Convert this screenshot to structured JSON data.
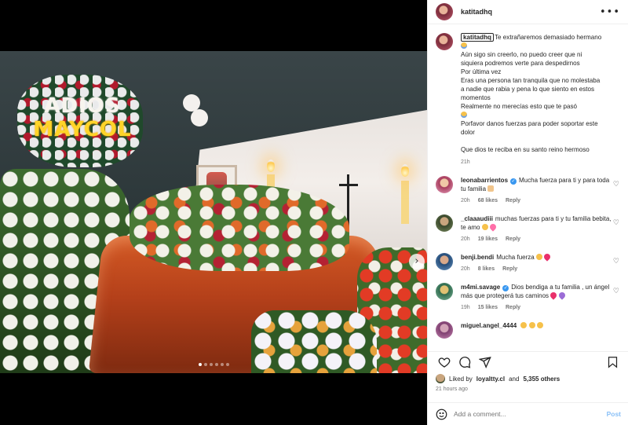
{
  "media": {
    "wreath_line1": "ADIOS",
    "wreath_line2": "MAYCOL",
    "dots_count": 6,
    "active_dot": 0
  },
  "post": {
    "username": "katitadhq",
    "caption_first": "Te extrañaremos demasiado hermano",
    "caption_lines": [
      "Aún sigo sin creerlo, no puedo creer que ni",
      "siquiera podremos verte para despedirnos",
      "Por última vez",
      "Eras una persona tan tranquila que no molestaba",
      "a nadie que rabia y pena lo que siento en estos",
      "momentos",
      "Realmente no merecías esto que te pasó"
    ],
    "caption_lines2": [
      "Porfavor danos fuerzas para poder soportar este",
      "dolor"
    ],
    "caption_last": "Que dios te reciba en su santo reino hermoso",
    "caption_time": "21h"
  },
  "comments": [
    {
      "user": "leonabarrientos",
      "verified": true,
      "text": "Mucha fuerza para ti y para toda tu familia",
      "emoji": "pray",
      "time": "20h",
      "likes": "68 likes",
      "reply": "Reply"
    },
    {
      "user": "_claaaudiii",
      "verified": false,
      "text": "muchas fuerzas para ti y tu familia bebita, te amo",
      "emoji": "hearts",
      "time": "20h",
      "likes": "19 likes",
      "reply": "Reply"
    },
    {
      "user": "benji.bendi",
      "verified": false,
      "text": "Mucha fuerza",
      "emoji": "heart",
      "time": "20h",
      "likes": "8 likes",
      "reply": "Reply"
    },
    {
      "user": "m4mi.savage",
      "verified": true,
      "text": "Dios bendiga a tu familia , un ángel más que protegerá tus caminos",
      "emoji": "purple",
      "time": "19h",
      "likes": "15 likes",
      "reply": "Reply"
    },
    {
      "user": "miguel.angel_4444",
      "verified": false,
      "text": "",
      "emoji": "smile",
      "time": "",
      "likes": "",
      "reply": ""
    }
  ],
  "likes": {
    "prefix": "Liked by",
    "user": "loyaltty.cl",
    "and": "and",
    "count": "5,355 others"
  },
  "time_ago": "21 hours ago",
  "add_comment": {
    "placeholder": "Add a comment...",
    "post_label": "Post"
  }
}
